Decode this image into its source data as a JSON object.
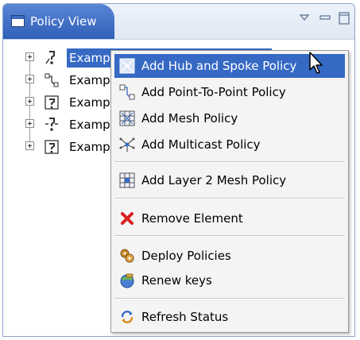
{
  "view": {
    "title": "Policy View",
    "icon": "view-icon",
    "controls": [
      "view-menu-icon",
      "minimize-icon",
      "maximize-icon"
    ]
  },
  "tree": {
    "items": [
      {
        "label": "Examp",
        "icon": "hub-spoke-policy-icon"
      },
      {
        "label": "Examp",
        "icon": "point-to-point-policy-icon"
      },
      {
        "label": "Examp",
        "icon": "mesh-policy-icon"
      },
      {
        "label": "Examp",
        "icon": "multicast-policy-icon"
      },
      {
        "label": "Examp",
        "icon": "mesh-policy-icon"
      }
    ]
  },
  "context_menu": {
    "items": [
      {
        "label": "Add Hub and Spoke Policy",
        "icon": "hub-spoke-icon",
        "highlighted": true
      },
      {
        "label": "Add Point-To-Point Policy",
        "icon": "point-to-point-icon"
      },
      {
        "label": "Add Mesh Policy",
        "icon": "mesh-icon"
      },
      {
        "label": "Add Multicast Policy",
        "icon": "multicast-icon"
      },
      {
        "label": "Add Layer 2 Mesh Policy",
        "icon": "layer2-mesh-icon"
      },
      {
        "label": "Remove Element",
        "icon": "remove-icon"
      },
      {
        "label": "Deploy Policies",
        "icon": "deploy-icon"
      },
      {
        "label": "Renew keys",
        "icon": "renew-keys-icon"
      },
      {
        "label": "Refresh Status",
        "icon": "refresh-icon"
      }
    ]
  },
  "colors": {
    "selection": "#3569c4",
    "tab": "#2f5fb8",
    "remove": "#d92020"
  }
}
